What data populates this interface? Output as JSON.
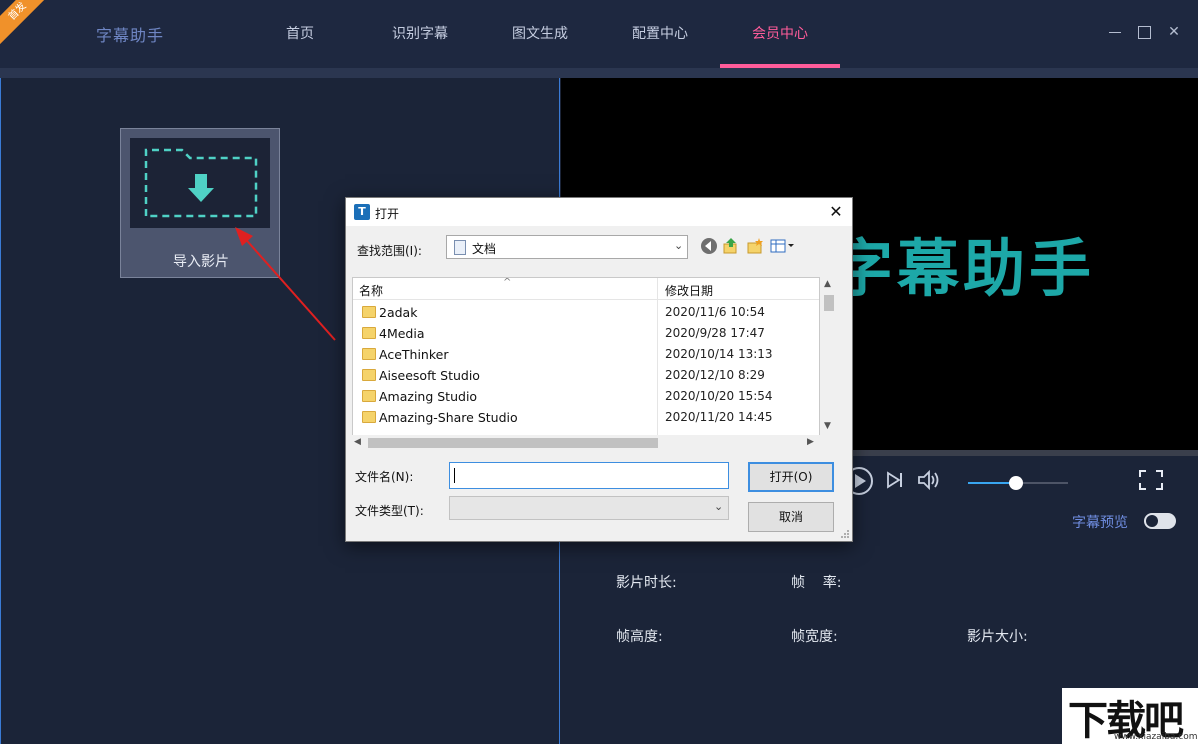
{
  "app": {
    "title": "字幕助手",
    "ribbon": "首发"
  },
  "nav": [
    {
      "label": "首页"
    },
    {
      "label": "识别字幕"
    },
    {
      "label": "图文生成"
    },
    {
      "label": "配置中心"
    },
    {
      "label": "会员中心",
      "active": true
    }
  ],
  "window_controls": [
    "minimize",
    "maximize",
    "close"
  ],
  "window_close_glyph": "✕",
  "import": {
    "label": "导入影片",
    "icon": "folder-download-icon"
  },
  "video": {
    "overlay_text": "字幕助手"
  },
  "player": {
    "volume_level": 0.48
  },
  "preview": {
    "label": "字幕预览",
    "toggle_on": false
  },
  "info": {
    "duration_label": "影片时长:",
    "framerate_label": "帧    率:",
    "frame_height_label": "帧高度:",
    "frame_width_label": "帧宽度:",
    "file_size_label": "影片大小:"
  },
  "watermark": {
    "text": "下载吧",
    "url": "www.xiazaiba.com"
  },
  "dialog": {
    "title": "打开",
    "close_glyph": "✕",
    "look_in_label": "查找范围(I):",
    "look_in_value": "文档",
    "columns": {
      "name": "名称",
      "date": "修改日期"
    },
    "sort_glyph": "^",
    "chevron_glyph": "⌄",
    "rows": [
      {
        "name": "2adak",
        "date": "2020/11/6 10:54"
      },
      {
        "name": "4Media",
        "date": "2020/9/28 17:47"
      },
      {
        "name": "AceThinker",
        "date": "2020/10/14 13:13"
      },
      {
        "name": "Aiseesoft Studio",
        "date": "2020/12/10 8:29"
      },
      {
        "name": "Amazing Studio",
        "date": "2020/10/20 15:54"
      },
      {
        "name": "Amazing-Share Studio",
        "date": "2020/11/20 14:45"
      }
    ],
    "filename_label": "文件名(N):",
    "filename_value": "",
    "filetype_label": "文件类型(T):",
    "filetype_value": "",
    "open_button": "打开(O)",
    "cancel_button": "取消"
  },
  "colors": {
    "accent": "#ff5c9a",
    "brand": "#6f86c4",
    "annotation_arrow": "#e02020",
    "overlay_text": "#1da8a8"
  }
}
